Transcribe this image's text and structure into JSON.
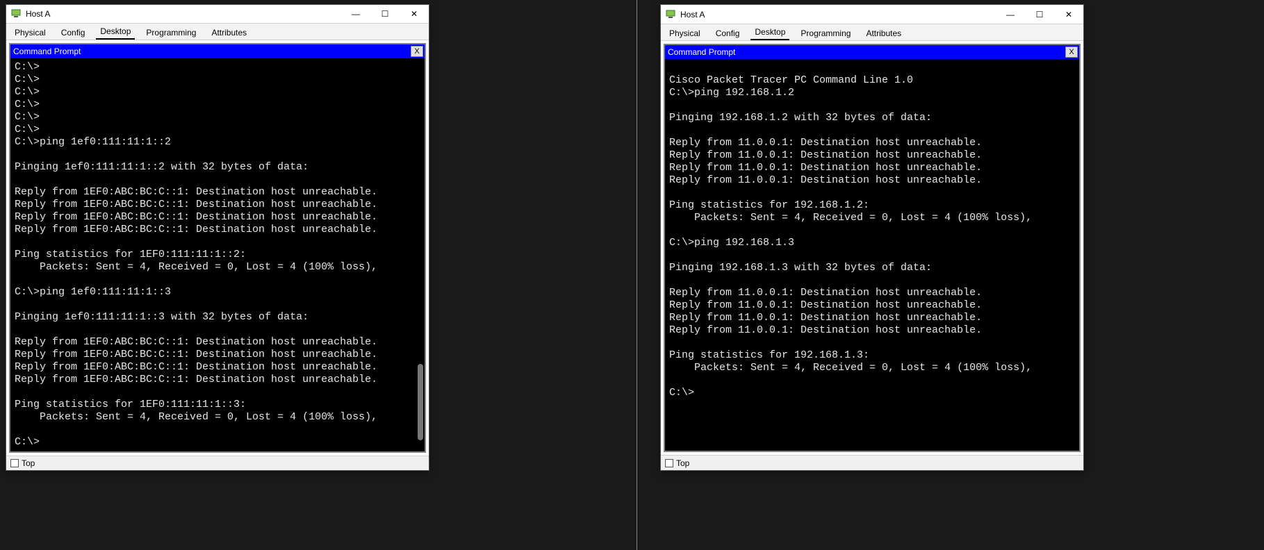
{
  "windows": [
    {
      "title": "Host A",
      "tabs": [
        "Physical",
        "Config",
        "Desktop",
        "Programming",
        "Attributes"
      ],
      "active_tab": "Desktop",
      "cmd_title": "Command Prompt",
      "cmd_close": "X",
      "top_label": "Top",
      "console": "C:\\>\nC:\\>\nC:\\>\nC:\\>\nC:\\>\nC:\\>\nC:\\>ping 1ef0:111:11:1::2\n\nPinging 1ef0:111:11:1::2 with 32 bytes of data:\n\nReply from 1EF0:ABC:BC:C::1: Destination host unreachable.\nReply from 1EF0:ABC:BC:C::1: Destination host unreachable.\nReply from 1EF0:ABC:BC:C::1: Destination host unreachable.\nReply from 1EF0:ABC:BC:C::1: Destination host unreachable.\n\nPing statistics for 1EF0:111:11:1::2:\n    Packets: Sent = 4, Received = 0, Lost = 4 (100% loss),\n\nC:\\>ping 1ef0:111:11:1::3\n\nPinging 1ef0:111:11:1::3 with 32 bytes of data:\n\nReply from 1EF0:ABC:BC:C::1: Destination host unreachable.\nReply from 1EF0:ABC:BC:C::1: Destination host unreachable.\nReply from 1EF0:ABC:BC:C::1: Destination host unreachable.\nReply from 1EF0:ABC:BC:C::1: Destination host unreachable.\n\nPing statistics for 1EF0:111:11:1::3:\n    Packets: Sent = 4, Received = 0, Lost = 4 (100% loss),\n\nC:\\>"
    },
    {
      "title": "Host A",
      "tabs": [
        "Physical",
        "Config",
        "Desktop",
        "Programming",
        "Attributes"
      ],
      "active_tab": "Desktop",
      "cmd_title": "Command Prompt",
      "cmd_close": "X",
      "top_label": "Top",
      "console": "\nCisco Packet Tracer PC Command Line 1.0\nC:\\>ping 192.168.1.2\n\nPinging 192.168.1.2 with 32 bytes of data:\n\nReply from 11.0.0.1: Destination host unreachable.\nReply from 11.0.0.1: Destination host unreachable.\nReply from 11.0.0.1: Destination host unreachable.\nReply from 11.0.0.1: Destination host unreachable.\n\nPing statistics for 192.168.1.2:\n    Packets: Sent = 4, Received = 0, Lost = 4 (100% loss),\n\nC:\\>ping 192.168.1.3\n\nPinging 192.168.1.3 with 32 bytes of data:\n\nReply from 11.0.0.1: Destination host unreachable.\nReply from 11.0.0.1: Destination host unreachable.\nReply from 11.0.0.1: Destination host unreachable.\nReply from 11.0.0.1: Destination host unreachable.\n\nPing statistics for 192.168.1.3:\n    Packets: Sent = 4, Received = 0, Lost = 4 (100% loss),\n\nC:\\>"
    }
  ],
  "winctrl": {
    "min": "—",
    "max": "☐",
    "close": "✕"
  }
}
